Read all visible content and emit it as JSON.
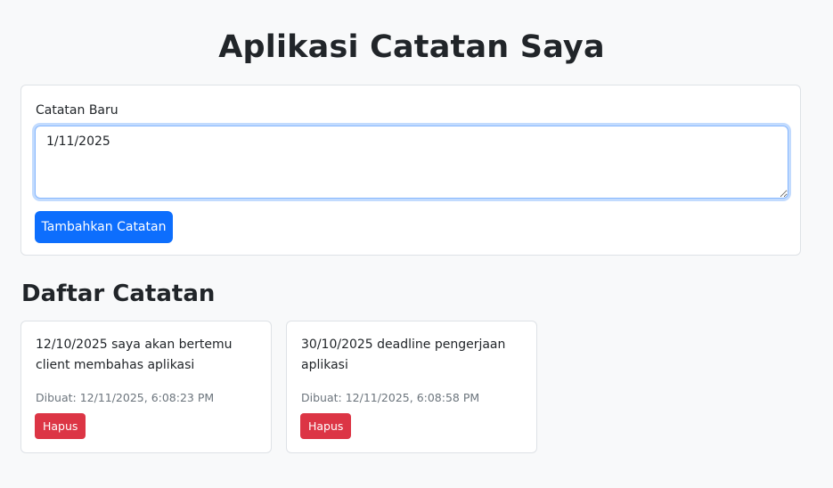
{
  "header": {
    "title": "Aplikasi Catatan Saya"
  },
  "form": {
    "label": "Catatan Baru",
    "textarea_value": "1/11/2025",
    "submit_label": "Tambahkan Catatan"
  },
  "notes_section": {
    "title": "Daftar Catatan",
    "notes": [
      {
        "text": "12/10/2025 saya akan bertemu client membahas aplikasi",
        "created": "Dibuat: 12/11/2025, 6:08:23 PM",
        "delete_label": "Hapus"
      },
      {
        "text": "30/10/2025 deadline pengerjaan aplikasi",
        "created": "Dibuat: 12/11/2025, 6:08:58 PM",
        "delete_label": "Hapus"
      }
    ]
  },
  "colors": {
    "background": "#f8f9fa",
    "primary": "#0d6efd",
    "danger": "#dc3545",
    "muted_text": "#6c757d"
  }
}
